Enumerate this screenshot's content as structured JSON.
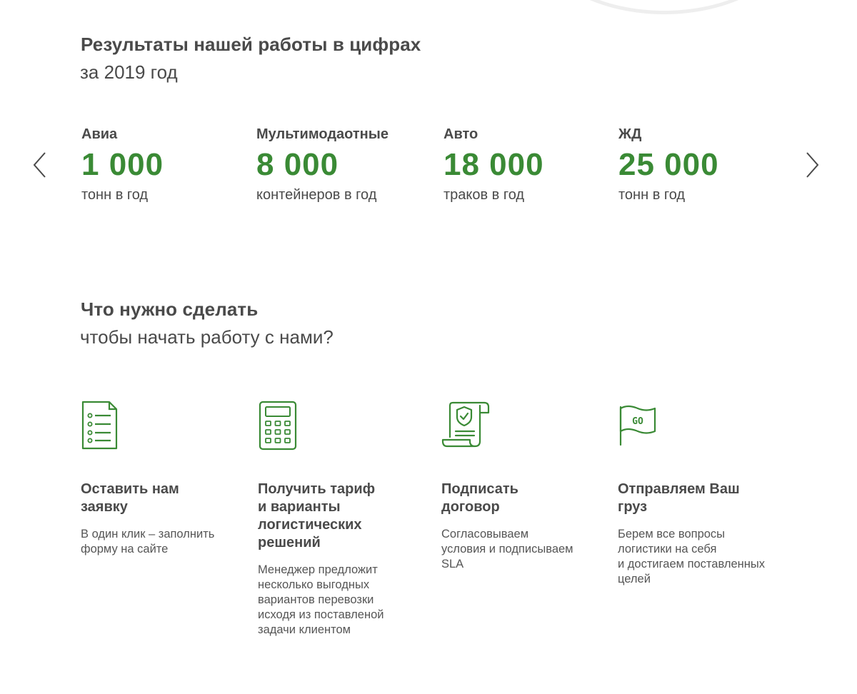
{
  "results": {
    "title": "Результаты нашей работы в цифрах",
    "subtitle": "за 2019 год",
    "stats": [
      {
        "label": "Авиа",
        "value": "1 000",
        "unit": "тонн в год"
      },
      {
        "label": "Мультимодаотные",
        "value": "8 000",
        "unit": "контейнеров в год"
      },
      {
        "label": "Авто",
        "value": "18 000",
        "unit": "траков в год"
      },
      {
        "label": "ЖД",
        "value": "25 000",
        "unit": "тонн в год"
      }
    ],
    "nav": {
      "prev_icon": "chevron-left-icon",
      "next_icon": "chevron-right-icon"
    }
  },
  "steps": {
    "title": "Что нужно сделать",
    "subtitle": "чтобы начать работу с нами?",
    "items": [
      {
        "icon": "document-list-icon",
        "title_lines": [
          "Оставить нам",
          "заявку"
        ],
        "desc_lines": [
          "В один клик – заполнить",
          "форму на сайте"
        ]
      },
      {
        "icon": "calculator-icon",
        "title_lines": [
          "Получить тариф",
          "и варианты",
          "логистических",
          "решений"
        ],
        "desc_lines": [
          "Менеджер предложит",
          "несколько выгодных",
          "вариантов перевозки",
          "исходя из поставленой",
          "задачи клиентом"
        ]
      },
      {
        "icon": "contract-scroll-icon",
        "title_lines": [
          "Подписать",
          "договор"
        ],
        "desc_lines": [
          "Согласовываем",
          "условия и подписываем",
          "SLA"
        ]
      },
      {
        "icon": "go-flag-icon",
        "title_lines": [
          "Отправляем Ваш",
          "груз"
        ],
        "desc_lines": [
          "Берем все вопросы",
          "логистики на себя",
          "и достигаем поставленных",
          "целей"
        ]
      }
    ]
  },
  "colors": {
    "accent": "#3a8a35",
    "text": "#4a4a4a",
    "arc": "#eeeeee"
  }
}
